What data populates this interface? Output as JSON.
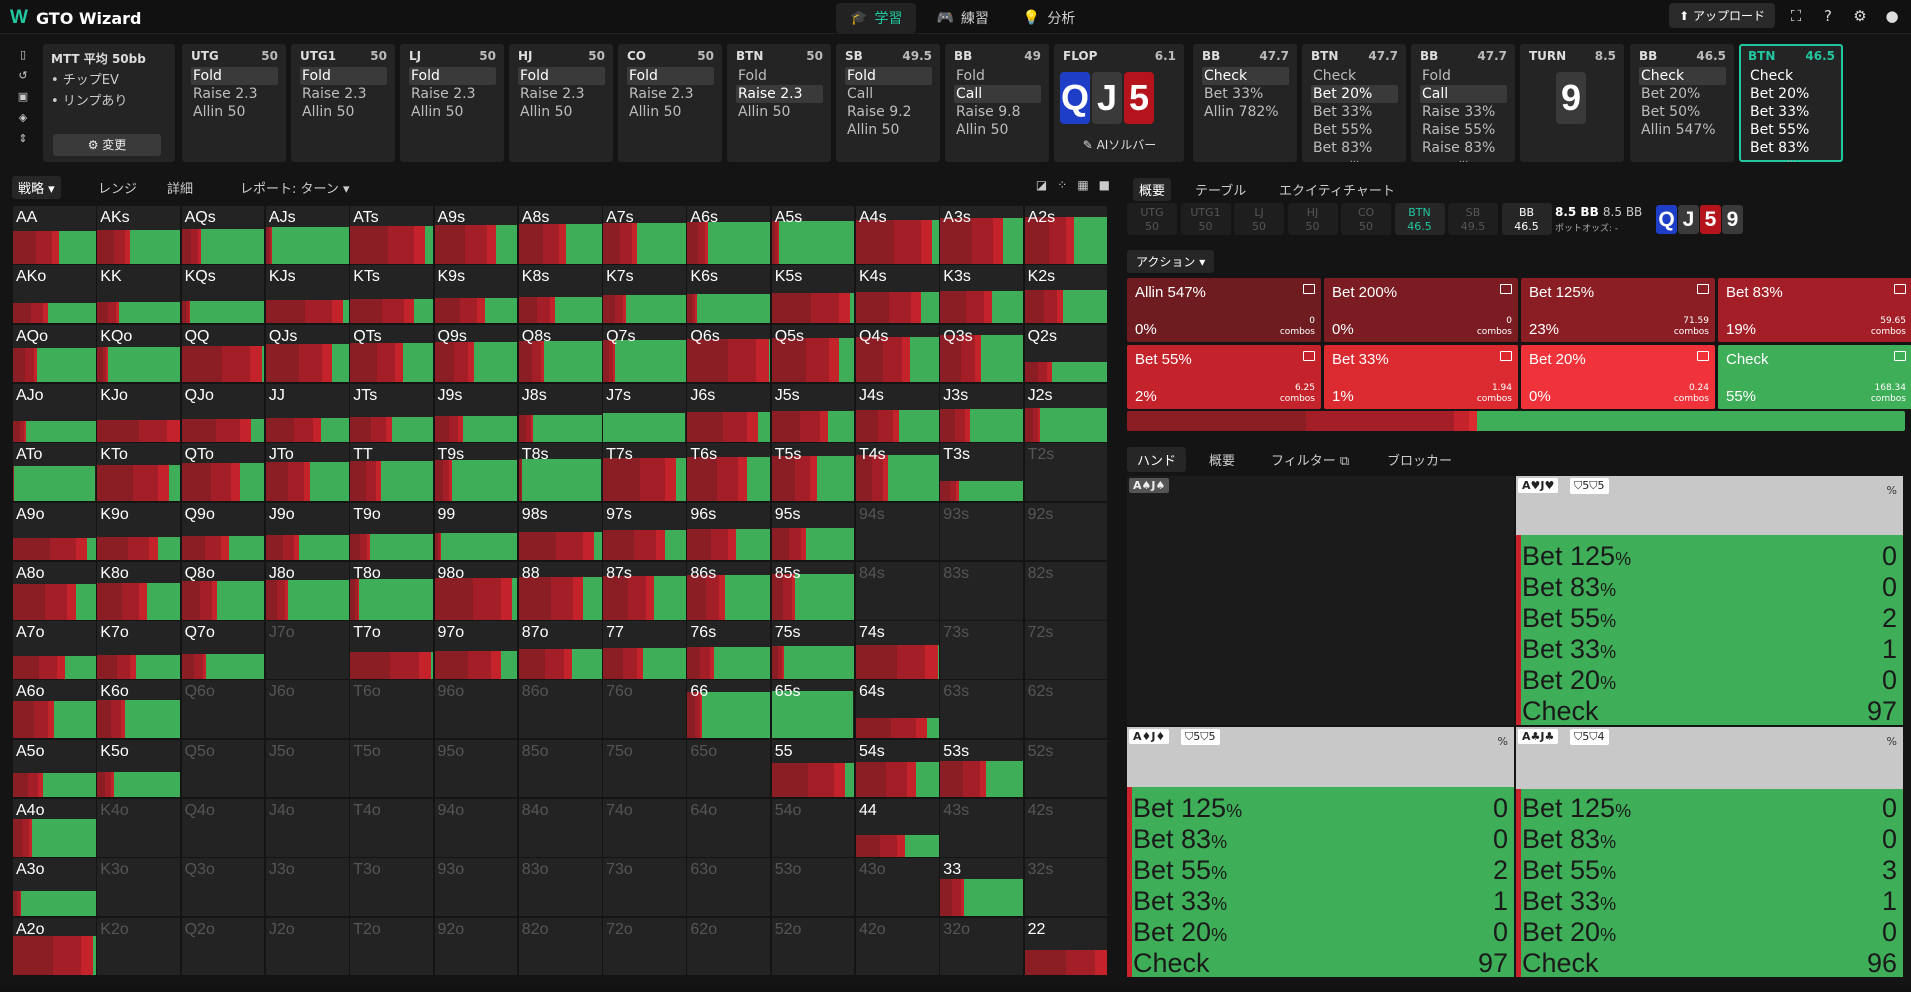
{
  "app": {
    "title": "GTO Wizard",
    "logo_mark": "W"
  },
  "nav": {
    "tabs": [
      {
        "label": "学習",
        "icon": "graduation-cap-icon",
        "active": true
      },
      {
        "label": "練習",
        "icon": "gamepad-icon",
        "active": false
      },
      {
        "label": "分析",
        "icon": "lightbulb-icon",
        "active": false
      }
    ]
  },
  "topright": {
    "upload_label": "アップロード"
  },
  "info": {
    "title": "MTT 平均 50bb",
    "lines": [
      "• チップEV",
      "• リンプあり"
    ],
    "change_label": "変更"
  },
  "columns": [
    {
      "pos": "UTG",
      "stack": "50",
      "actions": [
        "Fold",
        "Raise 2.3",
        "Allin 50"
      ],
      "selected": 0
    },
    {
      "pos": "UTG1",
      "stack": "50",
      "actions": [
        "Fold",
        "Raise 2.3",
        "Allin 50"
      ],
      "selected": 0
    },
    {
      "pos": "LJ",
      "stack": "50",
      "actions": [
        "Fold",
        "Raise 2.3",
        "Allin 50"
      ],
      "selected": 0
    },
    {
      "pos": "HJ",
      "stack": "50",
      "actions": [
        "Fold",
        "Raise 2.3",
        "Allin 50"
      ],
      "selected": 0
    },
    {
      "pos": "CO",
      "stack": "50",
      "actions": [
        "Fold",
        "Raise 2.3",
        "Allin 50"
      ],
      "selected": 0
    },
    {
      "pos": "BTN",
      "stack": "50",
      "actions": [
        "Fold",
        "Raise 2.3",
        "Allin 50"
      ],
      "selected": 1
    },
    {
      "pos": "SB",
      "stack": "49.5",
      "actions": [
        "Fold",
        "Call",
        "Raise 9.2",
        "Allin 50"
      ],
      "selected": 0
    },
    {
      "pos": "BB",
      "stack": "49",
      "actions": [
        "Fold",
        "Call",
        "Raise 9.8",
        "Allin 50"
      ],
      "selected": 1
    },
    {
      "pos": "FLOP",
      "stack": "6.1",
      "cards": [
        {
          "r": "Q",
          "s": "d"
        },
        {
          "r": "J",
          "s": "s"
        },
        {
          "r": "5",
          "s": "h"
        }
      ],
      "ai_label": "AIソルバー"
    },
    {
      "pos": "BB",
      "stack": "47.7",
      "actions": [
        "Check",
        "Bet 33%",
        "Allin 782%"
      ],
      "selected": 0
    },
    {
      "pos": "BTN",
      "stack": "47.7",
      "actions": [
        "Check",
        "Bet 20%",
        "Bet 33%",
        "Bet 55%",
        "Bet 83%"
      ],
      "selected": 1,
      "more": "..."
    },
    {
      "pos": "BB",
      "stack": "47.7",
      "actions": [
        "Fold",
        "Call",
        "Raise 33%",
        "Raise 55%",
        "Raise 83%"
      ],
      "selected": 1,
      "more": "..."
    },
    {
      "pos": "TURN",
      "stack": "8.5",
      "cards": [
        {
          "r": "9",
          "s": "s"
        }
      ]
    },
    {
      "pos": "BB",
      "stack": "46.5",
      "actions": [
        "Check",
        "Bet 20%",
        "Bet 50%",
        "Allin 547%"
      ],
      "selected": 0
    },
    {
      "pos": "BTN",
      "stack": "46.5",
      "actions": [
        "Check",
        "Bet 20%",
        "Bet 33%",
        "Bet 55%",
        "Bet 83%"
      ],
      "selected": -1,
      "more": "...",
      "active": true
    }
  ],
  "left_tabs": {
    "strategy": "戦略",
    "range": "レンジ",
    "detail": "詳細",
    "report": "レポート: ターン"
  },
  "ranks": [
    "A",
    "K",
    "Q",
    "J",
    "T",
    "9",
    "8",
    "7",
    "6",
    "5",
    "4",
    "3",
    "2"
  ],
  "empty_hands": [
    "T2s",
    "94s",
    "93s",
    "92s",
    "84s",
    "83s",
    "82s",
    "J7o",
    "73s",
    "72s",
    "Q6o",
    "J6o",
    "T6o",
    "96o",
    "86o",
    "76o",
    "63s",
    "62s",
    "Q5o",
    "J5o",
    "T5o",
    "95o",
    "85o",
    "75o",
    "65o",
    "52s",
    "K4o",
    "Q4o",
    "J4o",
    "T4o",
    "94o",
    "84o",
    "74o",
    "64o",
    "54o",
    "43s",
    "42s",
    "K3o",
    "Q3o",
    "J3o",
    "T3o",
    "93o",
    "83o",
    "73o",
    "63o",
    "53o",
    "43o",
    "32s",
    "K2o",
    "Q2o",
    "J2o",
    "T2o",
    "92o",
    "82o",
    "72o",
    "62o",
    "52o",
    "42o",
    "32o"
  ],
  "right_tabs": {
    "overview": "概要",
    "table": "テーブル",
    "equity": "エクイティチャート"
  },
  "stacks": [
    {
      "pos": "UTG",
      "val": "50",
      "cls": ""
    },
    {
      "pos": "UTG1",
      "val": "50",
      "cls": ""
    },
    {
      "pos": "LJ",
      "val": "50",
      "cls": ""
    },
    {
      "pos": "HJ",
      "val": "50",
      "cls": ""
    },
    {
      "pos": "CO",
      "val": "50",
      "cls": ""
    },
    {
      "pos": "BTN",
      "val": "46.5",
      "cls": "hl"
    },
    {
      "pos": "SB",
      "val": "49.5",
      "cls": ""
    },
    {
      "pos": "BB",
      "val": "46.5",
      "cls": "bb"
    }
  ],
  "pot": {
    "main": "8.5 BB",
    "sub": "8.5 BB",
    "odds": "ポットオッズ: -"
  },
  "board": [
    {
      "r": "Q",
      "s": "d"
    },
    {
      "r": "J",
      "s": "s"
    },
    {
      "r": "5",
      "s": "h"
    },
    {
      "r": "9",
      "s": "s"
    }
  ],
  "action_label": "アクション",
  "actions": [
    {
      "name": "Allin 547%",
      "pct": "0%",
      "combos": "0",
      "color": "#6e1c20"
    },
    {
      "name": "Bet 200%",
      "pct": "0%",
      "combos": "0",
      "color": "#7a1c22"
    },
    {
      "name": "Bet 125%",
      "pct": "23%",
      "combos": "71.59",
      "color": "#8b1d24"
    },
    {
      "name": "Bet 83%",
      "pct": "19%",
      "combos": "59.65",
      "color": "#a41e27"
    },
    {
      "name": "Bet 55%",
      "pct": "2%",
      "combos": "6.25",
      "color": "#c4232b"
    },
    {
      "name": "Bet 33%",
      "pct": "1%",
      "combos": "1.94",
      "color": "#dc2a31"
    },
    {
      "name": "Bet 20%",
      "pct": "0%",
      "combos": "0.24",
      "color": "#f0323a"
    },
    {
      "name": "Check",
      "pct": "55%",
      "combos": "168.34",
      "color": "#3fae58"
    }
  ],
  "combos_label": "combos",
  "hand_tabs": {
    "hand": "ハンド",
    "overview": "概要",
    "filter": "フィルター",
    "blocker": "ブロッカー"
  },
  "hand_panels": [
    {
      "tag": "A♠J♠",
      "empty": true
    },
    {
      "tag": "A♥J♥",
      "blocker": "5 5",
      "check_pct": 97,
      "rows": [
        [
          "Bet 125",
          "0"
        ],
        [
          "Bet 83",
          "0"
        ],
        [
          "Bet 55",
          "2"
        ],
        [
          "Bet 33",
          "1"
        ],
        [
          "Bet 20",
          "0"
        ],
        [
          "Check",
          "97"
        ]
      ]
    },
    {
      "tag": "A♦J♦",
      "blocker": "5 5",
      "check_pct": 97,
      "rows": [
        [
          "Bet 125",
          "0"
        ],
        [
          "Bet 83",
          "0"
        ],
        [
          "Bet 55",
          "2"
        ],
        [
          "Bet 33",
          "1"
        ],
        [
          "Bet 20",
          "0"
        ],
        [
          "Check",
          "97"
        ]
      ]
    },
    {
      "tag": "A♣J♣",
      "blocker": "5 4",
      "check_pct": 96,
      "rows": [
        [
          "Bet 125",
          "0"
        ],
        [
          "Bet 83",
          "0"
        ],
        [
          "Bet 55",
          "3"
        ],
        [
          "Bet 33",
          "1"
        ],
        [
          "Bet 20",
          "0"
        ],
        [
          "Check",
          "96"
        ]
      ]
    }
  ],
  "pct_symbol": "%",
  "colors": {
    "accent": "#22c7a0",
    "check": "#3fae58",
    "bet_dark": "#8b1d24",
    "bet_mid": "#a41e27",
    "bet_light": "#c4232b"
  }
}
